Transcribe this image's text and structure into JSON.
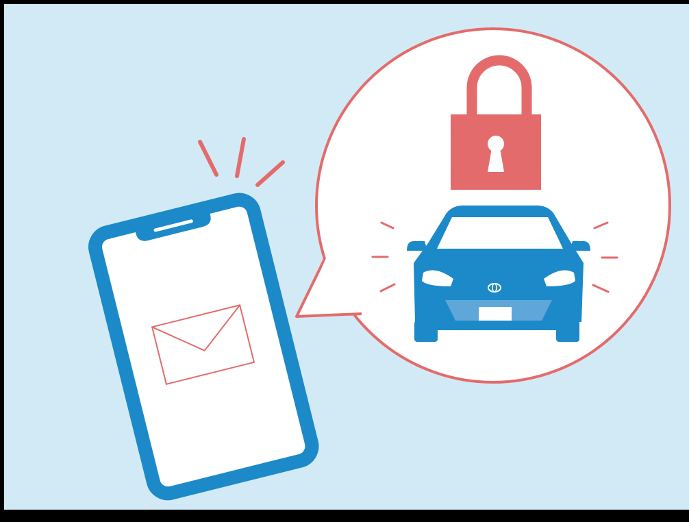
{
  "colors": {
    "background": "#d2eaf6",
    "phone_blue": "#1c89c9",
    "accent_red": "#e46b6b",
    "white": "#ffffff",
    "frame": "#000000"
  },
  "icons": {
    "phone": "smartphone-icon",
    "envelope": "envelope-icon",
    "notification": "notification-lines",
    "bubble": "speech-bubble",
    "lock": "unlocked-padlock-icon",
    "car": "car-icon",
    "emblem": "brand-emblem"
  }
}
